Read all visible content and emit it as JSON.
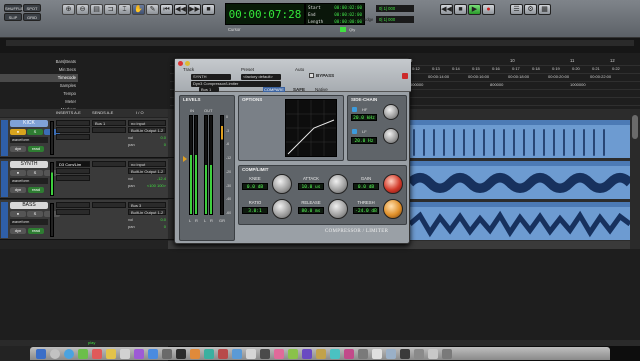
{
  "transport": {
    "modes": [
      "SHUFFLE",
      "SPOT",
      "SLIP",
      "GRID"
    ],
    "counter": "00:00:07:28",
    "start_label": "Start",
    "start": "00:00:02:00",
    "end_label": "End",
    "end": "00:00:02:00",
    "length_label": "Length",
    "length": "00:00:00:00",
    "cursor_label": "Cursor",
    "grid_value": "0| 1| 000",
    "nudge_label": "Nudge",
    "nudge_value": "0| 1| 000",
    "qty_label": "Qty"
  },
  "rulers": [
    "Bars|Beats",
    "Min:Secs",
    "Timecode",
    "Samples",
    "Tempo",
    "Meter",
    "Markers"
  ],
  "timecode_marks": [
    "0:12",
    "0:13",
    "0:14",
    "0:15",
    "0:16",
    "0:17",
    "0:18",
    "0:19",
    "0:20",
    "0:21",
    "0:22"
  ],
  "bar_marks": [
    "9",
    "10",
    "11",
    "12"
  ],
  "tc_values": [
    "00:00:14:00",
    "00:00:16:00",
    "00:00:18:00",
    "00:00:20:00",
    "00:00:22:00"
  ],
  "sample_values": [
    "600000",
    "800000",
    "1000000"
  ],
  "columns": {
    "inserts": "INSERTS A-E",
    "sends": "SENDS A-E",
    "io": "I / O"
  },
  "tracks": [
    {
      "name": "KICK",
      "view": "waveform",
      "send": "Bus 1",
      "input": "no input",
      "output": "Built-in Output 1-2",
      "vol_label": "vol",
      "vol": "0.0",
      "pan_label": "pan",
      "pan": "0",
      "insert": ""
    },
    {
      "name": "SYNTH",
      "view": "waveform",
      "send": "",
      "input": "no input",
      "output": "Built-in Output 1-2",
      "vol_label": "vol",
      "vol": "-12.4",
      "pan_label": "pan",
      "pan": "<100 100>",
      "insert": "D3 Com/Lim"
    },
    {
      "name": "BASS",
      "view": "waveform",
      "send": "",
      "input": "Bus 3",
      "output": "Built-in Output 1-2",
      "vol_label": "vol",
      "vol": "0.0",
      "pan_label": "pan",
      "pan": "0",
      "insert": ""
    }
  ],
  "track_buttons": {
    "dyn": "dyn",
    "read": "read",
    "s": "S",
    "m": "M"
  },
  "plugin": {
    "track_label": "Track",
    "preset_label": "Preset",
    "auto_label": "Auto",
    "track": "SYNTH",
    "preset": "<factory default>",
    "instance": "Dyn3 Compressor/Limiter",
    "bypass": "BYPASS",
    "compare": "COMPARE",
    "safe": "SAFE",
    "native": "Native",
    "key": "Bus 1",
    "levels": "LEVELS",
    "options": "OPTIONS",
    "sidechain": "SIDE-CHAIN",
    "in": "IN",
    "out": "OUT",
    "gr": "GR",
    "meter_ticks": [
      "0",
      "-3",
      "-6",
      "-12",
      "-20",
      "-30",
      "-40",
      "-60"
    ],
    "hf": "HF",
    "lf": "LF",
    "hf_value": "20.0 kHz",
    "lf_value": "20.0 Hz",
    "complimit": "COMP/LIMIT",
    "knee_label": "KNEE",
    "knee": "0.0 dB",
    "attack_label": "ATTACK",
    "attack": "10.0 us",
    "gain_label": "GAIN",
    "gain": "0.0 dB",
    "ratio_label": "RATIO",
    "ratio": "3.0:1",
    "release_label": "RELEASE",
    "release": "80.0 ms",
    "thresh_label": "THRESH",
    "thresh": "-24.0 dB",
    "brand": "COMPRESSOR / LIMITER"
  },
  "status": "play",
  "colors": {
    "accent_green": "#34e63a",
    "clip_blue": "#6d9bd1",
    "plugin_grey": "#9aa0a6"
  }
}
